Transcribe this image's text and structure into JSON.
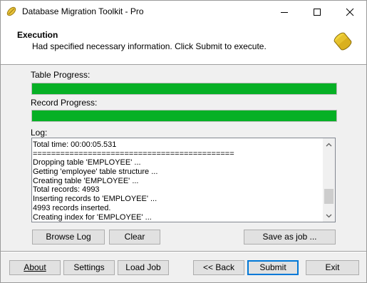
{
  "window": {
    "title": "Database Migration Toolkit - Pro"
  },
  "header": {
    "title": "Execution",
    "subtitle": "Had specified necessary information. Click Submit to execute."
  },
  "table_progress": {
    "label": "Table Progress:",
    "value": 1.0
  },
  "record_progress": {
    "label": "Record Progress:",
    "value": 1.0
  },
  "log": {
    "label": "Log:",
    "lines": [
      "Total time: 00:00:05.531",
      "============================================",
      "Dropping table 'EMPLOYEE' ...",
      "Getting 'employee' table structure ...",
      "Creating table 'EMPLOYEE' ...",
      "Total records: 4993",
      "Inserting records to 'EMPLOYEE' ...",
      "4993 records inserted.",
      "Creating index for 'EMPLOYEE' ..."
    ]
  },
  "log_buttons": {
    "browse_log": "Browse Log",
    "clear": "Clear",
    "save_as_job": "Save as job ..."
  },
  "footer": {
    "about": "About",
    "settings": "Settings",
    "load_job": "Load Job",
    "back": "<< Back",
    "submit": "Submit",
    "exit": "Exit"
  },
  "colors": {
    "progress_fill": "#06b025",
    "default_button_border": "#0078d7"
  }
}
